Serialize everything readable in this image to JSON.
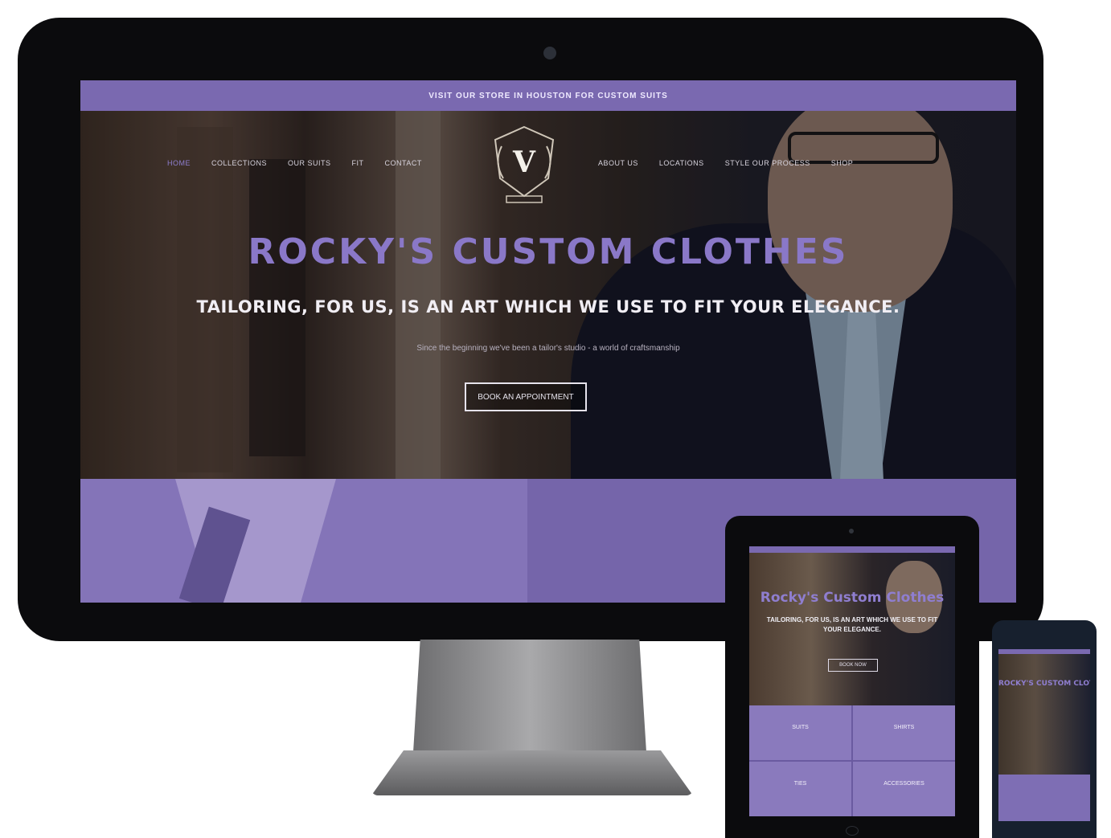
{
  "desktop": {
    "announcement": "VISIT OUR STORE IN HOUSTON FOR CUSTOM SUITS",
    "nav_left": [
      "HOME",
      "COLLECTIONS",
      "OUR SUITS",
      "FIT",
      "CONTACT"
    ],
    "nav_right": [
      "ABOUT US",
      "LOCATIONS",
      "STYLE OUR PROCESS",
      "SHOP"
    ],
    "logo_letter": "V",
    "hero_title": "ROCKY'S CUSTOM CLOTHES",
    "hero_subtitle": "TAILORING, FOR US, IS AN ART WHICH WE USE TO FIT YOUR ELEGANCE.",
    "hero_small": "Since the beginning we've been a tailor's studio - a world of craftsmanship",
    "hero_button": "BOOK AN APPOINTMENT"
  },
  "tablet": {
    "hero_title": "Rocky's Custom Clothes",
    "hero_subtitle": "TAILORING, FOR US, IS AN ART WHICH WE USE TO FIT YOUR ELEGANCE.",
    "hero_button": "BOOK NOW",
    "tiles": [
      "SUITS",
      "SHIRTS",
      "TIES",
      "ACCESSORIES"
    ]
  },
  "phone": {
    "hero_title": "ROCKY'S CUSTOM CLOTHES"
  },
  "colors": {
    "brand_purple": "#7a69b0",
    "title_purple": "#8a78c8",
    "device_black": "#0b0b0d"
  }
}
